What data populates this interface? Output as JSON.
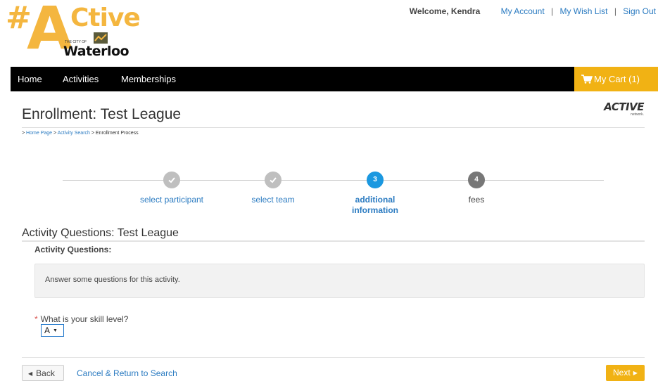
{
  "brand": {
    "hash": "#",
    "a": "A",
    "ctive": "Ctive",
    "city_prefix": "THE CITY OF",
    "city": "Waterloo"
  },
  "top_links": {
    "welcome": "Welcome, Kendra",
    "my_account": "My Account",
    "wish_list": "My Wish List",
    "sign_out": "Sign Out",
    "separator": "|"
  },
  "nav": {
    "items": [
      "Home",
      "Activities",
      "Memberships"
    ],
    "cart_label": "My Cart (1)"
  },
  "page": {
    "title": "Enrollment: Test League",
    "partner_logo": "ACTIVE",
    "partner_logo_sub": "network.",
    "breadcrumb": {
      "prefix": ">",
      "home": "Home Page",
      "search": "Activity Search",
      "current": "Enrollment Process"
    }
  },
  "stepper": {
    "steps": [
      {
        "label": "select participant",
        "status": "done",
        "badge": "check-icon"
      },
      {
        "label": "select team",
        "status": "done",
        "badge": "check-icon"
      },
      {
        "label": "additional information",
        "status": "current",
        "badge": "3"
      },
      {
        "label": "fees",
        "status": "todo",
        "badge": "4"
      }
    ]
  },
  "questions": {
    "section_title": "Activity Questions: Test League",
    "sub_title": "Activity Questions:",
    "info_text": "Answer some questions for this activity.",
    "required_mark": "*",
    "question_label": "What is your skill level?",
    "skill_value": "A"
  },
  "footer": {
    "back_label": "Back",
    "cancel_label": "Cancel & Return to Search",
    "next_label": "Next"
  },
  "colors": {
    "brand_yellow": "#f4b63f",
    "cart_yellow": "#f1b214",
    "link_blue": "#2b7bc1",
    "step_current": "#1b98e0",
    "step_done": "#bfbfbf",
    "step_todo": "#777777",
    "nav_bg": "#000000"
  }
}
